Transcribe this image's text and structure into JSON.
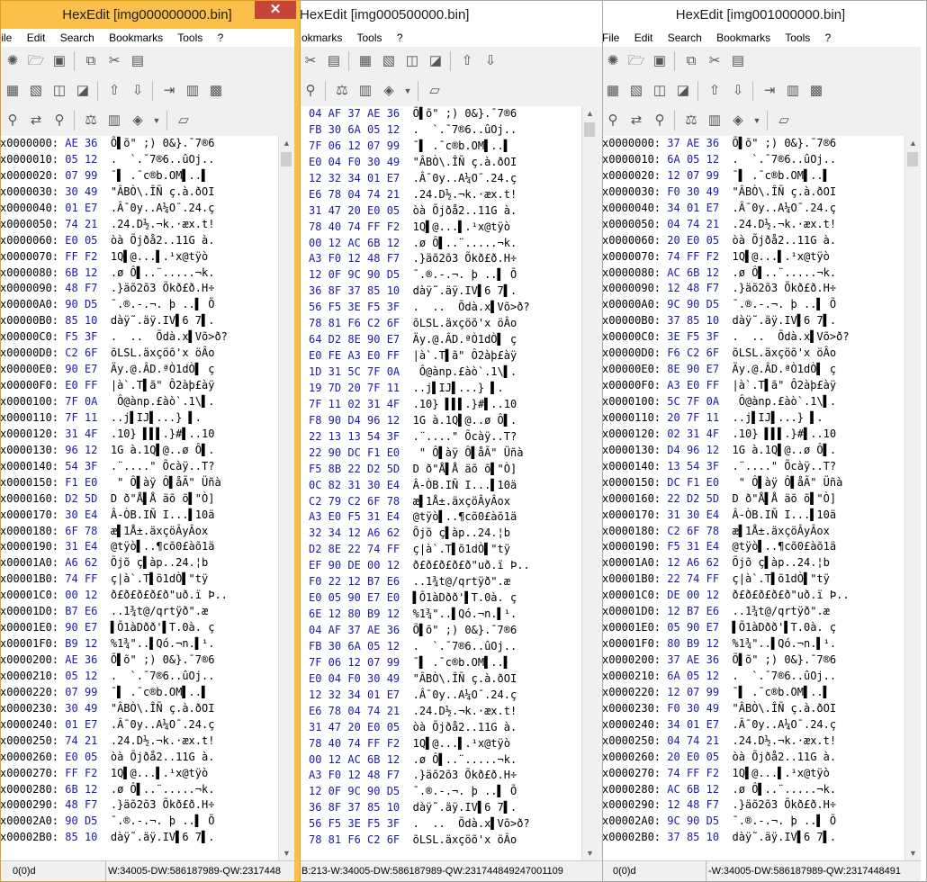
{
  "windows": [
    {
      "title": "HexEdit [img000000000.bin]",
      "status_left": "0(0)d",
      "status_right": "W:34005-DW:586187989-QW:2317448"
    },
    {
      "title": "HexEdit [img000500000.bin]",
      "status_left": "",
      "status_right": "B:213-W:34005-DW:586187989-QW:231744849247001109"
    },
    {
      "title": "HexEdit [img001000000.bin]",
      "status_left": "0(0)d",
      "status_right": "-W:34005-DW:586187989-QW:2317448491"
    }
  ],
  "menu": [
    "File",
    "Edit",
    "Search",
    "Bookmarks",
    "Tools",
    "?"
  ],
  "menu_w2": [
    "okmarks",
    "Tools",
    "?"
  ],
  "close_glyph": "✕",
  "w1_rows": [
    {
      "off": "x0000000:",
      "hex": "AE 36",
      "asc": "Õ▌õ\" ;) 0&}.¯7®6"
    },
    {
      "off": "x0000010:",
      "hex": "05 12",
      "asc": ".  `.¯7®6..ûOj.."
    },
    {
      "off": "x0000020:",
      "hex": "07 99",
      "asc": "¯▌ .¯c®b.OM▌..▌"
    },
    {
      "off": "x0000030:",
      "hex": "30 49",
      "asc": "\"ÂBÒ\\.ÎÑ ç.à.ðOI"
    },
    {
      "off": "x0000040:",
      "hex": "01 E7",
      "asc": ".Â¯0y..A¼O¯.24.ç"
    },
    {
      "off": "x0000050:",
      "hex": "74 21",
      "asc": ".24.D½.¬k.·æx.t!"
    },
    {
      "off": "x0000060:",
      "hex": "E0 05",
      "asc": "òà Õjðå2..11G à."
    },
    {
      "off": "x0000070:",
      "hex": "FF F2",
      "asc": "1Q▌@...▌.¹x@tÿò"
    },
    {
      "off": "x0000080:",
      "hex": "6B 12",
      "asc": ".ø Ô▌..¨.....¬k."
    },
    {
      "off": "x0000090:",
      "hex": "48 F7",
      "asc": ".}äõ2õ3 Õkð£ð.H÷"
    },
    {
      "off": "x00000A0:",
      "hex": "90 D5",
      "asc": "¯.®.-.¬. þ ..▌ Õ"
    },
    {
      "off": "x00000B0:",
      "hex": "85 10",
      "asc": "dàÿ˜.äÿ.IV▌6 7▌."
    },
    {
      "off": "x00000C0:",
      "hex": "F5 3F",
      "asc": ".  ..  Õdà.x▌Võ>ð?"
    },
    {
      "off": "x00000D0:",
      "hex": "C2 6F",
      "asc": "õLSL.äxçöõ'x öÂo"
    },
    {
      "off": "x00000E0:",
      "hex": "90 E7",
      "asc": "Äy.@.ÂD.ªÒ1dÒ▌ ç"
    },
    {
      "off": "x00000F0:",
      "hex": "E0 FF",
      "asc": "|à`.T▌ã\" Ô2àþ£àÿ"
    },
    {
      "off": "x0000100:",
      "hex": "7F 0A",
      "asc": " Ô@ànp.£àò`.1\\▌."
    },
    {
      "off": "x0000110:",
      "hex": "7F 11",
      "asc": "..j▌IJ▌...} ▌."
    },
    {
      "off": "x0000120:",
      "hex": "31 4F",
      "asc": ".10} ▌▌▌.}#▌..10"
    },
    {
      "off": "x0000130:",
      "hex": "96 12",
      "asc": "1G à.1Q▌@..ø Ô▌."
    },
    {
      "off": "x0000140:",
      "hex": "54 3F",
      "asc": ".¨....\" Õcàÿ..T?"
    },
    {
      "off": "x0000150:",
      "hex": "F1 E0",
      "asc": " \" Ô▌àÿ Ô▌åÃ\" Üñà"
    },
    {
      "off": "x0000160:",
      "hex": "D2 5D",
      "asc": "D ð\"Å▌Å äõ õ▌\"Ò]"
    },
    {
      "off": "x0000170:",
      "hex": "30 E4",
      "asc": "Â-ÒB.IÑ I...▌10ä"
    },
    {
      "off": "x0000180:",
      "hex": "6F 78",
      "asc": "æ▌1Å±.äxçöÂyÂox"
    },
    {
      "off": "x0000190:",
      "hex": "31 E4",
      "asc": "@tÿò▌..¶cõ0£àõ1ä"
    },
    {
      "off": "x00001A0:",
      "hex": "A6 62",
      "asc": "Õjõ ç▌àp..24.¦b"
    },
    {
      "off": "x00001B0:",
      "hex": "74 FF",
      "asc": "ç|à`.T▌õ1dÒ▌\"tÿ"
    },
    {
      "off": "x00001C0:",
      "hex": "00 12",
      "asc": "ð£ð£ð£ð£ð\"uð.ï Þ.."
    },
    {
      "off": "x00001D0:",
      "hex": "B7 E6",
      "asc": "..1¾t@/qrtÿð\".æ"
    },
    {
      "off": "x00001E0:",
      "hex": "90 E7",
      "asc": "▌Õ1àDðð'▌T.0à. ç"
    },
    {
      "off": "x00001F0:",
      "hex": "B9 12",
      "asc": "%1¾\"..▌Qó.¬n.▌¹."
    },
    {
      "off": "x0000200:",
      "hex": "AE 36",
      "asc": "Õ▌õ\" ;) 0&}.¯7®6"
    },
    {
      "off": "x0000210:",
      "hex": "05 12",
      "asc": ".  `.¯7®6..ûOj.."
    },
    {
      "off": "x0000220:",
      "hex": "07 99",
      "asc": "¯▌ .¯c®b.OM▌..▌"
    },
    {
      "off": "x0000230:",
      "hex": "30 49",
      "asc": "\"ÂBÒ\\.ÎÑ ç.à.ðOI"
    },
    {
      "off": "x0000240:",
      "hex": "01 E7",
      "asc": ".Â¯0y..A¼O¯.24.ç"
    },
    {
      "off": "x0000250:",
      "hex": "74 21",
      "asc": ".24.D½.¬k.·æx.t!"
    },
    {
      "off": "x0000260:",
      "hex": "E0 05",
      "asc": "òà Õjðå2..11G à."
    },
    {
      "off": "x0000270:",
      "hex": "FF F2",
      "asc": "1Q▌@...▌.¹x@tÿò"
    },
    {
      "off": "x0000280:",
      "hex": "6B 12",
      "asc": ".ø Ô▌..¨.....¬k."
    },
    {
      "off": "x0000290:",
      "hex": "48 F7",
      "asc": ".}äõ2õ3 Õkð£ð.H÷"
    },
    {
      "off": "x00002A0:",
      "hex": "90 D5",
      "asc": "¯.®.-.¬. þ ..▌ Õ"
    },
    {
      "off": "x00002B0:",
      "hex": "85 10",
      "asc": "dàÿ˜.äÿ.IV▌6 7▌."
    }
  ],
  "w2_rows": [
    {
      "hex": "04 AF 37 AE 36",
      "asc": "Õ▌õ\" ;) 0&}.¯7®6"
    },
    {
      "hex": "FB 30 6A 05 12",
      "asc": ".  `.¯7®6..ûOj.."
    },
    {
      "hex": "7F 06 12 07 99",
      "asc": "¯▌ .¯c®b.OM▌..▌"
    },
    {
      "hex": "E0 04 F0 30 49",
      "asc": "\"ÂBÒ\\.ÎÑ ç.à.ðOI"
    },
    {
      "hex": "12 32 34 01 E7",
      "asc": ".Â¯0y..A¼O¯.24.ç"
    },
    {
      "hex": "E6 78 04 74 21",
      "asc": ".24.D½.¬k.·æx.t!"
    },
    {
      "hex": "31 47 20 E0 05",
      "asc": "òà Õjðå2..11G à."
    },
    {
      "hex": "78 40 74 FF F2",
      "asc": "1Q▌@...▌.¹x@tÿò"
    },
    {
      "hex": "00 12 AC 6B 12",
      "asc": ".ø Ô▌..¨.....¬k."
    },
    {
      "hex": "A3 F0 12 48 F7",
      "asc": ".}äõ2õ3 Õkð£ð.H÷"
    },
    {
      "hex": "12 0F 9C 90 D5",
      "asc": "¯.®.-.¬. þ ..▌ Õ"
    },
    {
      "hex": "36 8F 37 85 10",
      "asc": "dàÿ˜.äÿ.IV▌6 7▌."
    },
    {
      "hex": "56 F5 3E F5 3F",
      "asc": ".  ..  Õdà.x▌Võ>ð?"
    },
    {
      "hex": "78 81 F6 C2 6F",
      "asc": "õLSL.äxçöõ'x öÂo"
    },
    {
      "hex": "64 D2 8E 90 E7",
      "asc": "Äy.@.ÂD.ªÒ1dÒ▌ ç"
    },
    {
      "hex": "E0 FE A3 E0 FF",
      "asc": "|à`.T▌ã\" Ô2àþ£àÿ"
    },
    {
      "hex": "1D 31 5C 7F 0A",
      "asc": " Ô@ànp.£àò`.1\\▌."
    },
    {
      "hex": "19 7D 20 7F 11",
      "asc": "..j▌IJ▌...} ▌."
    },
    {
      "hex": "7F 11 02 31 4F",
      "asc": ".10} ▌▌▌.}#▌..10"
    },
    {
      "hex": "F8 90 D4 96 12",
      "asc": "1G à.1Q▌@..ø Ô▌."
    },
    {
      "hex": "22 13 13 54 3F",
      "asc": ".¨....\" Õcàÿ..T?"
    },
    {
      "hex": "22 90 DC F1 E0",
      "asc": " \" Ô▌àÿ Ô▌åÃ\" Üñà"
    },
    {
      "hex": "F5 8B 22 D2 5D",
      "asc": "D ð\"Å▌Å äõ õ▌\"Ò]"
    },
    {
      "hex": "0C 82 31 30 E4",
      "asc": "Â-ÒB.IÑ I...▌10ä"
    },
    {
      "hex": "C2 79 C2 6F 78",
      "asc": "æ▌1Å±.äxçöÂyÂox"
    },
    {
      "hex": "A3 E0 F5 31 E4",
      "asc": "@tÿò▌..¶cõ0£àõ1ä"
    },
    {
      "hex": "32 34 12 A6 62",
      "asc": "Õjõ ç▌àp..24.¦b"
    },
    {
      "hex": "D2 8E 22 74 FF",
      "asc": "ç|à`.T▌õ1dÒ▌\"tÿ"
    },
    {
      "hex": "EF 90 DE 00 12",
      "asc": "ð£ð£ð£ð£ð\"uð.ï Þ.."
    },
    {
      "hex": "F0 22 12 B7 E6",
      "asc": "..1¾t@/qrtÿð\".æ"
    },
    {
      "hex": "E0 05 90 E7 E0",
      "asc": "▌Õ1àDðð'▌T.0à. ç"
    },
    {
      "hex": "6E 12 80 B9 12",
      "asc": "%1¾\"..▌Qó.¬n.▌¹."
    },
    {
      "hex": "04 AF 37 AE 36",
      "asc": "Õ▌õ\" ;) 0&}.¯7®6"
    },
    {
      "hex": "FB 30 6A 05 12",
      "asc": ".  `.¯7®6..ûOj.."
    },
    {
      "hex": "7F 06 12 07 99",
      "asc": "¯▌ .¯c®b.OM▌..▌"
    },
    {
      "hex": "E0 04 F0 30 49",
      "asc": "\"ÂBÒ\\.ÎÑ ç.à.ðOI"
    },
    {
      "hex": "12 32 34 01 E7",
      "asc": ".Â¯0y..A¼O¯.24.ç"
    },
    {
      "hex": "E6 78 04 74 21",
      "asc": ".24.D½.¬k.·æx.t!"
    },
    {
      "hex": "31 47 20 E0 05",
      "asc": "òà Õjðå2..11G à."
    },
    {
      "hex": "78 40 74 FF F2",
      "asc": "1Q▌@...▌.¹x@tÿò"
    },
    {
      "hex": "00 12 AC 6B 12",
      "asc": ".ø Ô▌..¨.....¬k."
    },
    {
      "hex": "A3 F0 12 48 F7",
      "asc": ".}äõ2õ3 Õkð£ð.H÷"
    },
    {
      "hex": "12 0F 9C 90 D5",
      "asc": "¯.®.-.¬. þ ..▌ Õ"
    },
    {
      "hex": "36 8F 37 85 10",
      "asc": "dàÿ˜.äÿ.IV▌6 7▌."
    },
    {
      "hex": "56 F5 3E F5 3F",
      "asc": ".  ..  Õdà.x▌Võ>ð?"
    },
    {
      "hex": "78 81 F6 C2 6F",
      "asc": "õLSL.äxçöõ'x öÂo"
    }
  ],
  "w3_rows": [
    {
      "off": "x0000000:",
      "hex": "37 AE 36",
      "asc": "Õ▌õ\" ;) 0&}.¯7®6"
    },
    {
      "off": "x0000010:",
      "hex": "6A 05 12",
      "asc": ".  `.¯7®6..ûOj.."
    },
    {
      "off": "x0000020:",
      "hex": "12 07 99",
      "asc": "¯▌ .¯c®b.OM▌..▌"
    },
    {
      "off": "x0000030:",
      "hex": "F0 30 49",
      "asc": "\"ÂBÒ\\.ÎÑ ç.à.ðOI"
    },
    {
      "off": "x0000040:",
      "hex": "34 01 E7",
      "asc": ".Â¯0y..A¼O¯.24.ç"
    },
    {
      "off": "x0000050:",
      "hex": "04 74 21",
      "asc": ".24.D½.¬k.·æx.t!"
    },
    {
      "off": "x0000060:",
      "hex": "20 E0 05",
      "asc": "òà Õjðå2..11G à."
    },
    {
      "off": "x0000070:",
      "hex": "74 FF F2",
      "asc": "1Q▌@...▌.¹x@tÿò"
    },
    {
      "off": "x0000080:",
      "hex": "AC 6B 12",
      "asc": ".ø Ô▌..¨.....¬k."
    },
    {
      "off": "x0000090:",
      "hex": "12 48 F7",
      "asc": ".}äõ2õ3 Õkð£ð.H÷"
    },
    {
      "off": "x00000A0:",
      "hex": "9C 90 D5",
      "asc": "¯.®.-.¬. þ ..▌ Õ"
    },
    {
      "off": "x00000B0:",
      "hex": "37 85 10",
      "asc": "dàÿ˜.äÿ.IV▌6 7▌."
    },
    {
      "off": "x00000C0:",
      "hex": "3E F5 3F",
      "asc": ".  ..  Õdà.x▌Võ>ð?"
    },
    {
      "off": "x00000D0:",
      "hex": "F6 C2 6F",
      "asc": "õLSL.äxçöõ'x öÂo"
    },
    {
      "off": "x00000E0:",
      "hex": "8E 90 E7",
      "asc": "Äy.@.ÂD.ªÒ1dÒ▌ ç"
    },
    {
      "off": "x00000F0:",
      "hex": "A3 E0 FF",
      "asc": "|à`.T▌ã\" Ô2àþ£àÿ"
    },
    {
      "off": "x0000100:",
      "hex": "5C 7F 0A",
      "asc": " Ô@ànp.£àò`.1\\▌."
    },
    {
      "off": "x0000110:",
      "hex": "20 7F 11",
      "asc": "..j▌IJ▌...} ▌."
    },
    {
      "off": "x0000120:",
      "hex": "02 31 4F",
      "asc": ".10} ▌▌▌.}#▌..10"
    },
    {
      "off": "x0000130:",
      "hex": "D4 96 12",
      "asc": "1G à.1Q▌@..ø Ô▌."
    },
    {
      "off": "x0000140:",
      "hex": "13 54 3F",
      "asc": ".¨....\" Õcàÿ..T?"
    },
    {
      "off": "x0000150:",
      "hex": "DC F1 E0",
      "asc": " \" Ô▌àÿ Ô▌åÃ\" Üñà"
    },
    {
      "off": "x0000160:",
      "hex": "22 D2 5D",
      "asc": "D ð\"Å▌Å äõ õ▌\"Ò]"
    },
    {
      "off": "x0000170:",
      "hex": "31 30 E4",
      "asc": "Â-ÒB.IÑ I...▌10ä"
    },
    {
      "off": "x0000180:",
      "hex": "C2 6F 78",
      "asc": "æ▌1Å±.äxçöÂyÂox"
    },
    {
      "off": "x0000190:",
      "hex": "F5 31 E4",
      "asc": "@tÿò▌..¶cõ0£àõ1ä"
    },
    {
      "off": "x00001A0:",
      "hex": "12 A6 62",
      "asc": "Õjõ ç▌àp..24.¦b"
    },
    {
      "off": "x00001B0:",
      "hex": "22 74 FF",
      "asc": "ç|à`.T▌õ1dÒ▌\"tÿ"
    },
    {
      "off": "x00001C0:",
      "hex": "DE 00 12",
      "asc": "ð£ð£ð£ð£ð\"uð.ï Þ.."
    },
    {
      "off": "x00001D0:",
      "hex": "12 B7 E6",
      "asc": "..1¾t@/qrtÿð\".æ"
    },
    {
      "off": "x00001E0:",
      "hex": "05 90 E7",
      "asc": "▌Õ1àDðð'▌T.0à. ç"
    },
    {
      "off": "x00001F0:",
      "hex": "80 B9 12",
      "asc": "%1¾\"..▌Qó.¬n.▌¹."
    },
    {
      "off": "x0000200:",
      "hex": "37 AE 36",
      "asc": "Õ▌õ\" ;) 0&}.¯7®6"
    },
    {
      "off": "x0000210:",
      "hex": "6A 05 12",
      "asc": ".  `.¯7®6..ûOj.."
    },
    {
      "off": "x0000220:",
      "hex": "12 07 99",
      "asc": "¯▌ .¯c®b.OM▌..▌"
    },
    {
      "off": "x0000230:",
      "hex": "F0 30 49",
      "asc": "\"ÂBÒ\\.ÎÑ ç.à.ðOI"
    },
    {
      "off": "x0000240:",
      "hex": "34 01 E7",
      "asc": ".Â¯0y..A¼O¯.24.ç"
    },
    {
      "off": "x0000250:",
      "hex": "04 74 21",
      "asc": ".24.D½.¬k.·æx.t!"
    },
    {
      "off": "x0000260:",
      "hex": "20 E0 05",
      "asc": "òà Õjðå2..11G à."
    },
    {
      "off": "x0000270:",
      "hex": "74 FF F2",
      "asc": "1Q▌@...▌.¹x@tÿò"
    },
    {
      "off": "x0000280:",
      "hex": "AC 6B 12",
      "asc": ".ø Ô▌..¨.....¬k."
    },
    {
      "off": "x0000290:",
      "hex": "12 48 F7",
      "asc": ".}äõ2õ3 Õkð£ð.H÷"
    },
    {
      "off": "x00002A0:",
      "hex": "9C 90 D5",
      "asc": "¯.®.-.¬. þ ..▌ Õ"
    },
    {
      "off": "x00002B0:",
      "hex": "37 85 10",
      "asc": "dàÿ˜.äÿ.IV▌6 7▌."
    }
  ]
}
